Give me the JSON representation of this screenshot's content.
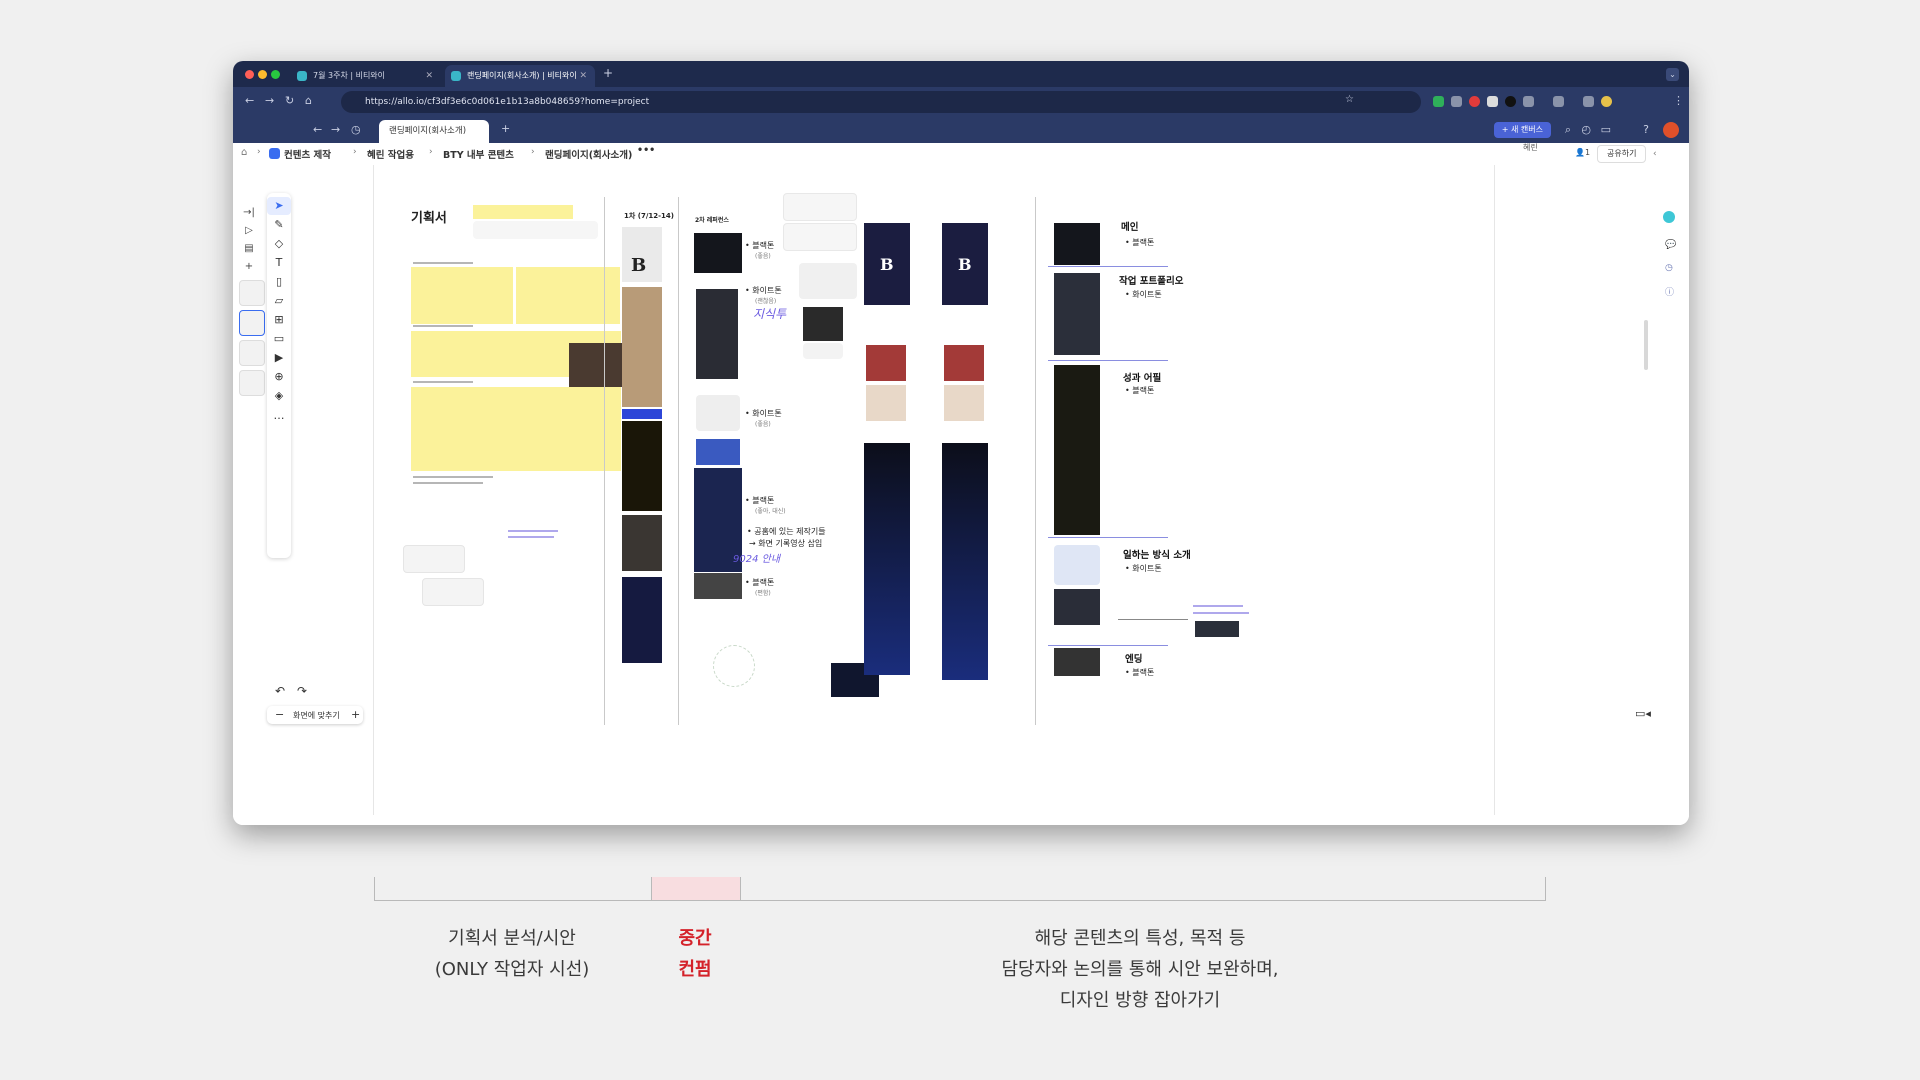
{
  "browser": {
    "tabs": [
      {
        "label": "7월 3주차 | 비티와이"
      },
      {
        "label": "랜딩페이지(회사소개) | 비티와이"
      }
    ],
    "url": "https://allo.io/cf3df3e6c0d061e1b13a8b048659?home=project"
  },
  "app": {
    "page_tab": "랜딩페이지(회사소개)",
    "new_canvas": "+ 새 캔버스",
    "user_tag": "혜린",
    "share": "공유하기",
    "viewer_count": "1",
    "breadcrumb": [
      "컨텐츠 제작",
      "혜린 작업용",
      "BTY 내부 콘텐츠",
      "랜딩페이지(회사소개)"
    ],
    "fit_screen": "화면에 맞추기"
  },
  "canvas": {
    "title": "기획서",
    "round1": "1차 (7/12-14)",
    "round2": "2차 레퍼런스",
    "ref_labels": [
      {
        "label": "블랙톤",
        "sub": "(좋음)"
      },
      {
        "label": "화이트톤",
        "sub": "(괜찮음)"
      },
      {
        "label": "화이트톤",
        "sub": "(좋음)"
      },
      {
        "label": "블랙톤",
        "sub": "(좋아, 대신)"
      },
      {
        "label": "블랙톤",
        "sub": "(편함)"
      }
    ],
    "notes": [
      "공홈에 있는 제작기들",
      "→ 화면 기록영상 삽입"
    ],
    "handwriting": [
      "9024 안내",
      "지식투"
    ],
    "sections": [
      {
        "title": "메인",
        "tone": "블랙톤"
      },
      {
        "title": "작업 포트폴리오",
        "tone": "화이트톤"
      },
      {
        "title": "성과 어필",
        "tone": "블랙톤"
      },
      {
        "title": "일하는 방식 소개",
        "tone": "화이트톤"
      },
      {
        "title": "엔딩",
        "tone": "블랙톤"
      }
    ]
  },
  "annotation": {
    "left": [
      "기획서 분석/시안",
      "(ONLY 작업자 시선)"
    ],
    "middle": [
      "중간",
      "컨펌"
    ],
    "right": [
      "해당 콘텐츠의 특성, 목적 등",
      "담당자와 논의를 통해 시안 보완하며,",
      "디자인 방향 잡아가기"
    ],
    "colors": {
      "highlight": "#d4222a",
      "accent": "#2d46d8"
    }
  }
}
